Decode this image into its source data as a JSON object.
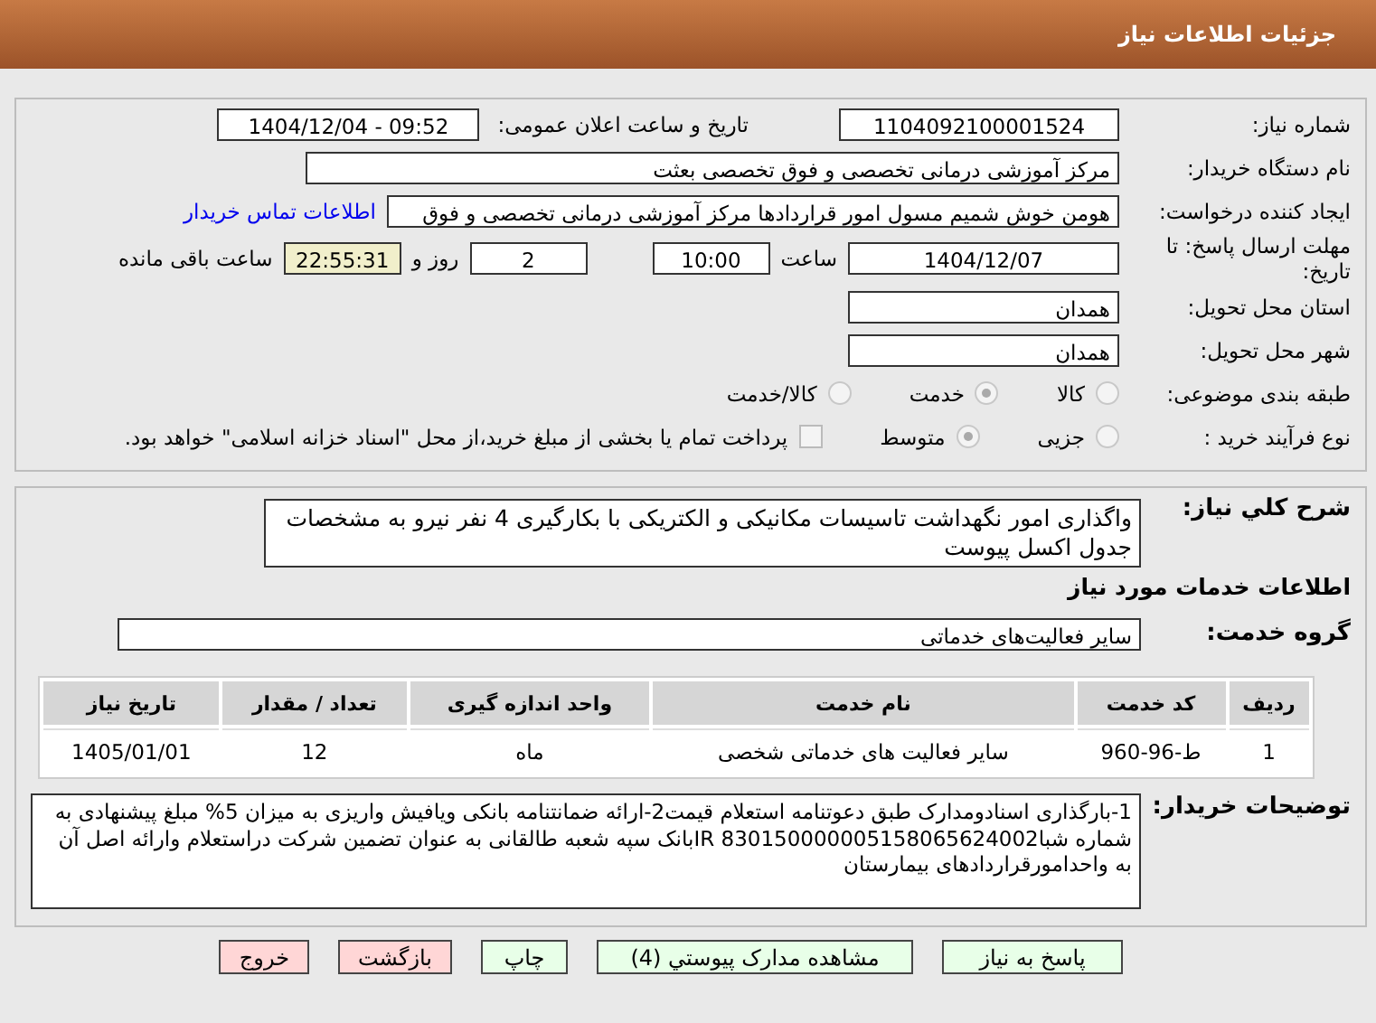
{
  "header": {
    "title": "جزئیات اطلاعات نیاز"
  },
  "need_number": {
    "label": "شماره نیاز:",
    "value": "1104092100001524"
  },
  "announce_date": {
    "label": "تاریخ و ساعت اعلان عمومی:",
    "value": "1404/12/04 - 09:52"
  },
  "buyer_org": {
    "label": "نام دستگاه خریدار:",
    "value": "مرکز آموزشی درمانی تخصصی و فوق تخصصی بعثت"
  },
  "requester": {
    "label": "ایجاد کننده درخواست:",
    "value": "هومن خوش شمیم مسول امور قراردادها مرکز آموزشی درمانی تخصصی و فوق ",
    "link": "اطلاعات تماس خریدار"
  },
  "deadline": {
    "label": "مهلت ارسال پاسخ: تا تاریخ:",
    "date": "1404/12/07",
    "time_label": "ساعت",
    "time": "10:00",
    "days": "2",
    "days_label": "روز و",
    "remaining": "22:55:31",
    "remaining_label": "ساعت باقی مانده"
  },
  "province": {
    "label": "استان محل تحویل:",
    "value": "همدان"
  },
  "city": {
    "label": "شهر محل تحویل:",
    "value": "همدان"
  },
  "category": {
    "label": "طبقه بندی موضوعی:",
    "options": [
      {
        "label": "کالا",
        "selected": false
      },
      {
        "label": "خدمت",
        "selected": true
      },
      {
        "label": "کالا/خدمت",
        "selected": false
      }
    ]
  },
  "process": {
    "label": "نوع فرآیند خرید :",
    "options": [
      {
        "label": "جزیی",
        "selected": false
      },
      {
        "label": "متوسط",
        "selected": true
      }
    ],
    "treasury": {
      "checked": false,
      "label": "پرداخت تمام یا بخشی از مبلغ خرید،از محل \"اسناد خزانه اسلامی\" خواهد بود."
    }
  },
  "description": {
    "label": "شرح کلي نياز:",
    "value": "واگذاری امور نگهداشت تاسیسات مکانیکی و الکتریکی با بکارگیری 4 نفر نیرو به مشخصات جدول اکسل پیوست"
  },
  "services_heading": "اطلاعات خدمات مورد نیاز",
  "service_group": {
    "label": "گروه خدمت:",
    "value": "سایر فعالیت‌های خدماتی"
  },
  "table": {
    "columns": [
      "ردیف",
      "کد خدمت",
      "نام خدمت",
      "واحد اندازه گیری",
      "تعداد / مقدار",
      "تاریخ نیاز"
    ],
    "rows": [
      [
        "1",
        "ط-96-960",
        "سایر فعالیت های خدماتی شخصی",
        "ماه",
        "12",
        "1405/01/01"
      ]
    ]
  },
  "buyer_notes": {
    "label": "توضیحات خریدار:",
    "value": "1-بارگذاری اسنادومدارک طبق دعوتنامه استعلام قیمت2-ارائه ضمانتنامه بانکی ویافیش واریزی به میزان 5% مبلغ پیشنهادی به شماره شباIR  830150000005158065624002بانک سپه شعبه طالقانی به عنوان تضمین شرکت دراستعلام وارائه اصل آن به واحدامورقراردادهای بیمارستان"
  },
  "buttons": [
    {
      "label": "پاسخ به نیاز",
      "kind": "green"
    },
    {
      "label": "مشاهده مدارک پیوستي (4)",
      "kind": "green"
    },
    {
      "label": "چاپ",
      "kind": "green"
    },
    {
      "label": "بازگشت",
      "kind": "red"
    },
    {
      "label": "خروج",
      "kind": "red"
    }
  ]
}
